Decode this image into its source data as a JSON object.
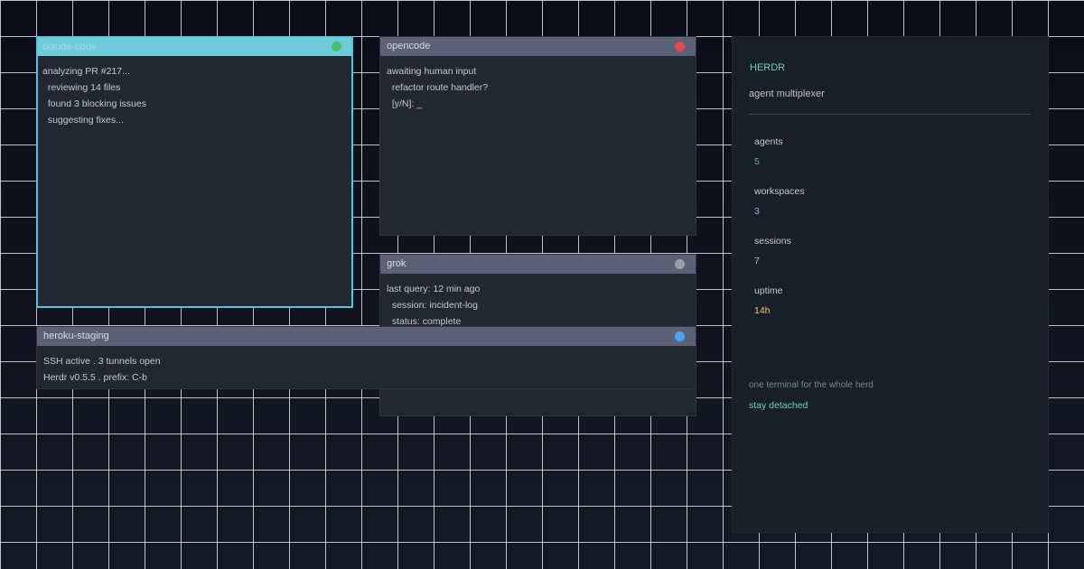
{
  "panes": {
    "claude": {
      "title": "claude-code",
      "status_color": "#44c26a",
      "lines": [
        "analyzing PR #217...",
        "  reviewing 14 files",
        "  found 3 blocking issues",
        "  suggesting fixes..."
      ]
    },
    "opencode": {
      "title": "opencode",
      "status_color": "#e5484d",
      "lines": [
        "awaiting human input",
        "  refactor route handler?",
        "  [y/N]: _"
      ]
    },
    "grok": {
      "title": "grok",
      "status_color": "#9aa0a8",
      "lines": [
        "last query: 12 min ago",
        "  session: incident-log",
        "  status: complete"
      ]
    },
    "heroku": {
      "title": "heroku-staging",
      "status_color": "#4aa3f5",
      "lines": [
        "SSH active . 3 tunnels open",
        "Herdr v0.5.5 . prefix: C-b"
      ]
    }
  },
  "sidebar": {
    "brand": "HERDR",
    "subtitle": "agent multiplexer",
    "stats": [
      {
        "label": "agents",
        "value": "5",
        "color": "#4fc38a"
      },
      {
        "label": "workspaces",
        "value": "3",
        "color": "#5cc4d8"
      },
      {
        "label": "sessions",
        "value": "7",
        "color": "#b8bec8"
      },
      {
        "label": "uptime",
        "value": "14h",
        "color": "#e2d27a"
      }
    ],
    "tagline": "one terminal for the whole herd",
    "motto": "stay detached"
  }
}
